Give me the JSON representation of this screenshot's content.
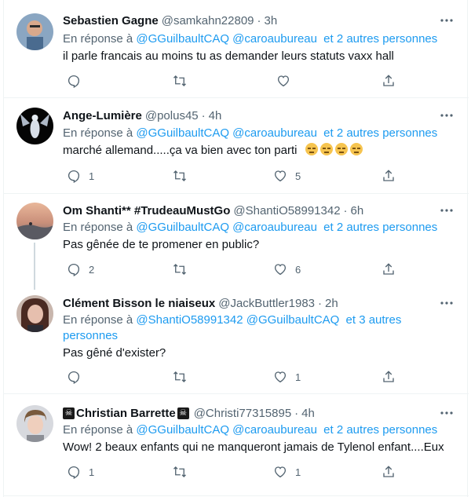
{
  "tweets": [
    {
      "name": "Sebastien Gagne",
      "handle": "@samkahn22809",
      "time": "3h",
      "reply_prefix": "En réponse à",
      "reply_targets": "@GGuilbaultCAQ @caroaubureau",
      "reply_more": "et 2 autres personnes",
      "text": "il parle francais au moins tu as demander leurs statuts vaxx hall",
      "replies": "",
      "retweets": "",
      "likes": ""
    },
    {
      "name": "Ange-Lumière",
      "handle": "@polus45",
      "time": "4h",
      "reply_prefix": "En réponse à",
      "reply_targets": "@GGuilbaultCAQ @caroaubureau",
      "reply_more": "et 2 autres personnes",
      "text": "marché allemand.....ça va bien avec ton parti",
      "emoji_names": [
        "expressionless-face-emoji",
        "expressionless-face-emoji",
        "expressionless-face-emoji",
        "expressionless-face-emoji"
      ],
      "replies": "1",
      "retweets": "",
      "likes": "5"
    },
    {
      "name": "Om Shanti** #TrudeauMustGo",
      "handle": "@ShantiO58991342",
      "time": "6h",
      "reply_prefix": "En réponse à",
      "reply_targets": "@GGuilbaultCAQ @caroaubureau",
      "reply_more": "et 2 autres personnes",
      "text": "Pas gênée de te promener en public?",
      "replies": "2",
      "retweets": "",
      "likes": "6"
    },
    {
      "name": "Clément Bisson le niaiseux",
      "handle": "@JackButtler1983",
      "time": "2h",
      "reply_prefix": "En réponse à",
      "reply_targets": "@ShantiO58991342 @GGuilbaultCAQ",
      "reply_more": "et 3 autres",
      "reply_more_line2": "personnes",
      "text": "Pas gêné d'exister?",
      "replies": "",
      "retweets": "",
      "likes": "1"
    },
    {
      "name": "Christian Barrette",
      "name_icons": [
        "skull-crossbones-icon",
        "skull-crossbones-icon"
      ],
      "handle": "@Christi77315895",
      "time": "4h",
      "reply_prefix": "En réponse à",
      "reply_targets": "@GGuilbaultCAQ @caroaubureau",
      "reply_more": "et 2 autres personnes",
      "text": "Wow! 2 beaux enfants qui ne manqueront jamais de Tylenol enfant....Eux",
      "replies": "1",
      "retweets": "",
      "likes": "1"
    }
  ],
  "separator": "·",
  "colors": {
    "link": "#1d9bf0",
    "secondary": "#536471",
    "text": "#0f1419",
    "border": "#eff3f4"
  }
}
